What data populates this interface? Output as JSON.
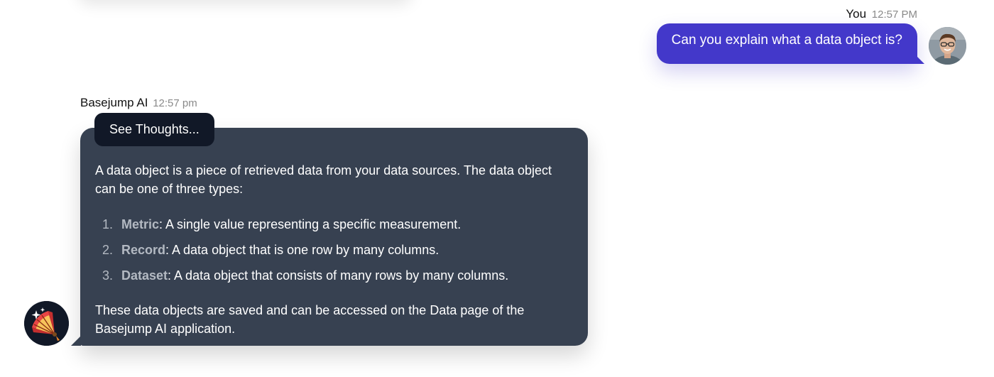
{
  "user_message": {
    "sender": "You",
    "time": "12:57 PM",
    "text": "Can you explain what a data object is?"
  },
  "ai_message": {
    "sender": "Basejump AI",
    "time": "12:57 pm",
    "thoughts_button_label": "See Thoughts...",
    "intro": "A data object is a piece of retrieved data from your data sources. The data object can be one of three types:",
    "items": [
      {
        "num": "1.",
        "term": "Metric",
        "desc": ": A single value representing a specific measurement."
      },
      {
        "num": "2.",
        "term": "Record",
        "desc": ": A data object that is one row by many columns."
      },
      {
        "num": "3.",
        "term": "Dataset",
        "desc": ": A data object that consists of many rows by many columns."
      }
    ],
    "outro": "These data objects are saved and can be accessed on the Data page of the Basejump AI application."
  },
  "colors": {
    "user_bubble": "#4338ca",
    "ai_bubble": "#374151",
    "thoughts_button": "#111827",
    "term_color": "#b3b9c2"
  },
  "icons": {
    "user_avatar": "user-photo-avatar",
    "ai_avatar": "folding-fan-sparkles-icon"
  }
}
